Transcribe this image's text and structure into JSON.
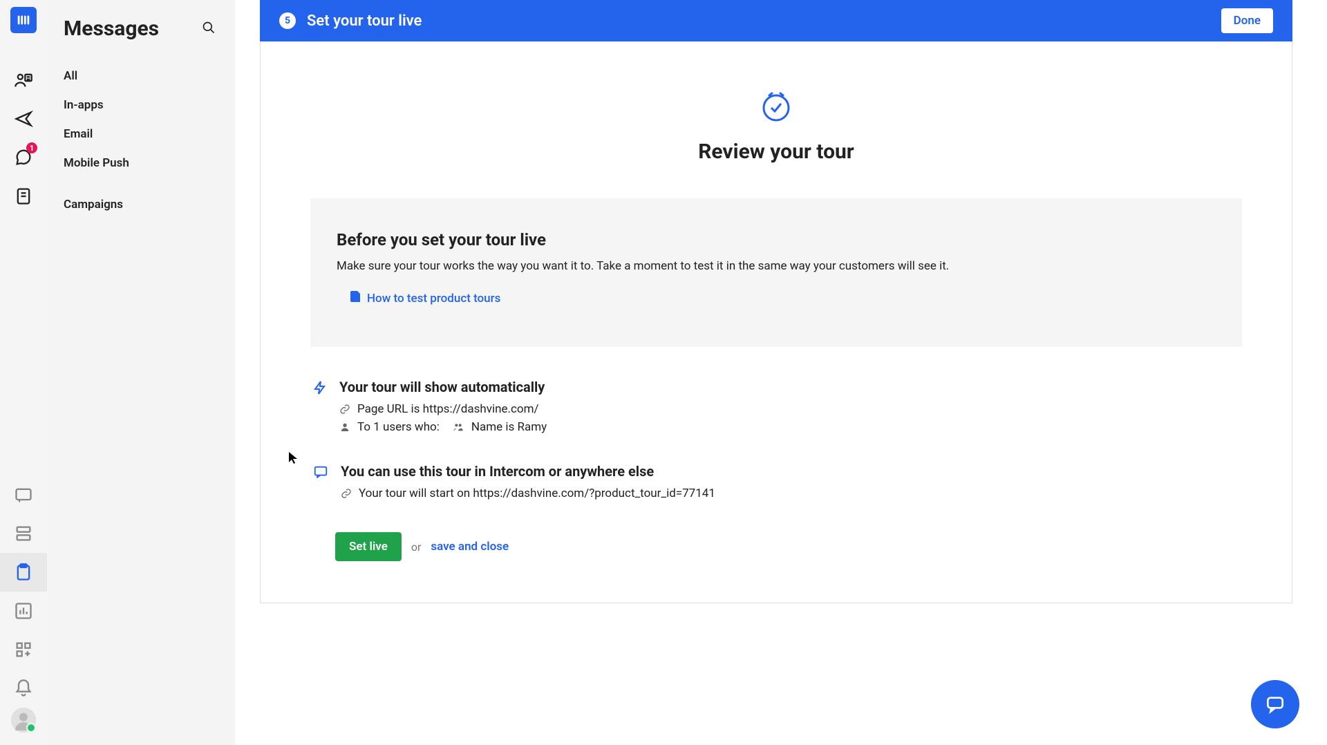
{
  "sidebar": {
    "title": "Messages",
    "items": [
      {
        "label": "All"
      },
      {
        "label": "In-apps"
      },
      {
        "label": "Email"
      },
      {
        "label": "Mobile Push"
      },
      {
        "label": "Campaigns"
      }
    ]
  },
  "rail": {
    "badge": "1"
  },
  "banner": {
    "step": "5",
    "title": "Set your tour live",
    "done": "Done"
  },
  "review": {
    "title": "Review your tour"
  },
  "info_card": {
    "title": "Before you set your tour live",
    "text": "Make sure your tour works the way you want it to. Take a moment to test it in the same way your customers will see it.",
    "link": "How to test product tours"
  },
  "auto_block": {
    "title": "Your tour will show automatically",
    "page_url": "Page URL is https://dashvine.com/",
    "to_users": "To 1 users who:",
    "name_rule": "Name is Ramy"
  },
  "use_block": {
    "title": "You can use this tour in Intercom or anywhere else",
    "start": "Your tour will start on https://dashvine.com/?product_tour_id=77141"
  },
  "actions": {
    "set_live": "Set live",
    "or": "or",
    "save_close": "save and close"
  }
}
